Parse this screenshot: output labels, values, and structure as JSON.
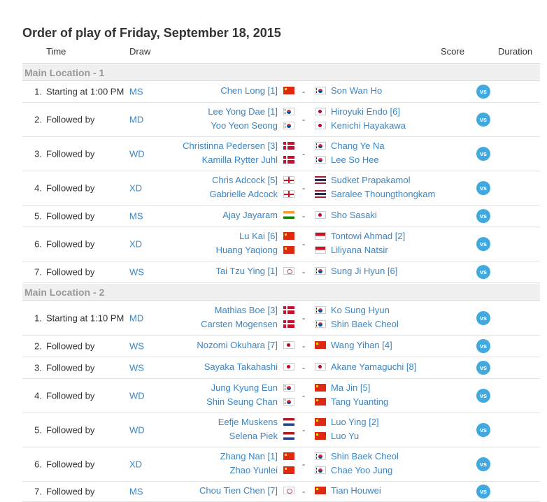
{
  "title": "Order of play of Friday, September 18, 2015",
  "headers": {
    "time": "Time",
    "draw": "Draw",
    "score": "Score",
    "duration": "Duration"
  },
  "vs_label": "vs",
  "dash": "-",
  "locations": [
    {
      "name": "Main Location - 1",
      "matches": [
        {
          "num": "1.",
          "time": "Starting at 1:00 PM",
          "draw": "MS",
          "left": [
            {
              "name": "Chen Long [1]",
              "flag": "china-flag-icon"
            }
          ],
          "right": [
            {
              "name": "Son Wan Ho",
              "flag": "korea-flag-icon"
            }
          ]
        },
        {
          "num": "2.",
          "time": "Followed by",
          "draw": "MD",
          "left": [
            {
              "name": "Lee Yong Dae [1]",
              "flag": "korea-flag-icon"
            },
            {
              "name": "Yoo Yeon Seong",
              "flag": "korea-flag-icon"
            }
          ],
          "right": [
            {
              "name": "Hiroyuki Endo [6]",
              "flag": "japan-flag-icon"
            },
            {
              "name": "Kenichi Hayakawa",
              "flag": "japan-flag-icon"
            }
          ]
        },
        {
          "num": "3.",
          "time": "Followed by",
          "draw": "WD",
          "left": [
            {
              "name": "Christinna Pedersen [3]",
              "flag": "denmark-flag-icon"
            },
            {
              "name": "Kamilla Rytter Juhl",
              "flag": "denmark-flag-icon"
            }
          ],
          "right": [
            {
              "name": "Chang Ye Na",
              "flag": "korea-flag-icon"
            },
            {
              "name": "Lee So Hee",
              "flag": "korea-flag-icon"
            }
          ]
        },
        {
          "num": "4.",
          "time": "Followed by",
          "draw": "XD",
          "left": [
            {
              "name": "Chris Adcock [5]",
              "flag": "england-flag-icon"
            },
            {
              "name": "Gabrielle Adcock",
              "flag": "england-flag-icon"
            }
          ],
          "right": [
            {
              "name": "Sudket Prapakamol",
              "flag": "thailand-flag-icon"
            },
            {
              "name": "Saralee Thoungthongkam",
              "flag": "thailand-flag-icon"
            }
          ]
        },
        {
          "num": "5.",
          "time": "Followed by",
          "draw": "MS",
          "left": [
            {
              "name": "Ajay Jayaram",
              "flag": "india-flag-icon"
            }
          ],
          "right": [
            {
              "name": "Sho Sasaki",
              "flag": "japan-flag-icon"
            }
          ]
        },
        {
          "num": "6.",
          "time": "Followed by",
          "draw": "XD",
          "left": [
            {
              "name": "Lu Kai [6]",
              "flag": "china-flag-icon"
            },
            {
              "name": "Huang Yaqiong",
              "flag": "china-flag-icon"
            }
          ],
          "right": [
            {
              "name": "Tontowi Ahmad [2]",
              "flag": "indonesia-flag-icon"
            },
            {
              "name": "Liliyana Natsir",
              "flag": "indonesia-flag-icon"
            }
          ]
        },
        {
          "num": "7.",
          "time": "Followed by",
          "draw": "WS",
          "left": [
            {
              "name": "Tai Tzu Ying [1]",
              "flag": "chinese-taipei-flag-icon"
            }
          ],
          "right": [
            {
              "name": "Sung Ji Hyun [6]",
              "flag": "korea-flag-icon"
            }
          ]
        }
      ]
    },
    {
      "name": "Main Location - 2",
      "matches": [
        {
          "num": "1.",
          "time": "Starting at 1:10 PM",
          "draw": "MD",
          "left": [
            {
              "name": "Mathias Boe [3]",
              "flag": "denmark-flag-icon"
            },
            {
              "name": "Carsten Mogensen",
              "flag": "denmark-flag-icon"
            }
          ],
          "right": [
            {
              "name": "Ko Sung Hyun",
              "flag": "korea-flag-icon"
            },
            {
              "name": "Shin Baek Cheol",
              "flag": "korea-flag-icon"
            }
          ]
        },
        {
          "num": "2.",
          "time": "Followed by",
          "draw": "WS",
          "left": [
            {
              "name": "Nozomi Okuhara [7]",
              "flag": "japan-flag-icon"
            }
          ],
          "right": [
            {
              "name": "Wang Yihan [4]",
              "flag": "china-flag-icon"
            }
          ]
        },
        {
          "num": "3.",
          "time": "Followed by",
          "draw": "WS",
          "left": [
            {
              "name": "Sayaka Takahashi",
              "flag": "japan-flag-icon"
            }
          ],
          "right": [
            {
              "name": "Akane Yamaguchi [8]",
              "flag": "japan-flag-icon"
            }
          ]
        },
        {
          "num": "4.",
          "time": "Followed by",
          "draw": "WD",
          "left": [
            {
              "name": "Jung Kyung Eun",
              "flag": "korea-flag-icon"
            },
            {
              "name": "Shin Seung Chan",
              "flag": "korea-flag-icon"
            }
          ],
          "right": [
            {
              "name": "Ma Jin [5]",
              "flag": "china-flag-icon"
            },
            {
              "name": "Tang Yuanting",
              "flag": "china-flag-icon"
            }
          ]
        },
        {
          "num": "5.",
          "time": "Followed by",
          "draw": "WD",
          "left": [
            {
              "name": "Eefje Muskens",
              "flag": "netherlands-flag-icon"
            },
            {
              "name": "Selena Piek",
              "flag": "netherlands-flag-icon"
            }
          ],
          "right": [
            {
              "name": "Luo Ying [2]",
              "flag": "china-flag-icon"
            },
            {
              "name": "Luo Yu",
              "flag": "china-flag-icon"
            }
          ]
        },
        {
          "num": "6.",
          "time": "Followed by",
          "draw": "XD",
          "left": [
            {
              "name": "Zhang Nan [1]",
              "flag": "china-flag-icon"
            },
            {
              "name": "Zhao Yunlei",
              "flag": "china-flag-icon"
            }
          ],
          "right": [
            {
              "name": "Shin Baek Cheol",
              "flag": "korea-flag-icon"
            },
            {
              "name": "Chae Yoo Jung",
              "flag": "korea-flag-icon"
            }
          ]
        },
        {
          "num": "7.",
          "time": "Followed by",
          "draw": "MS",
          "left": [
            {
              "name": "Chou Tien Chen [7]",
              "flag": "chinese-taipei-flag-icon"
            }
          ],
          "right": [
            {
              "name": "Tian Houwei",
              "flag": "china-flag-icon"
            }
          ]
        }
      ]
    }
  ]
}
